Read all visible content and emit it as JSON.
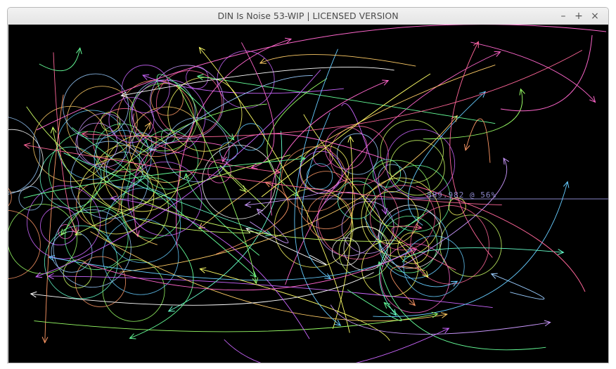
{
  "window": {
    "title": "DIN Is Noise 53-WIP | LICENSED VERSION",
    "minimize_glyph": "–",
    "maximize_glyph": "+",
    "close_glyph": "×"
  },
  "canvas": {
    "background": "#000000",
    "readout": "889.982 @ 56%",
    "readout_color": "#8a86c8",
    "palette": [
      "#ff66cc",
      "#ccff66",
      "#66ff99",
      "#99ccff",
      "#ffcc66",
      "#cc99ff",
      "#66ffcc",
      "#ff9966",
      "#ffff66",
      "#66ccff",
      "#ff6699",
      "#99ff66",
      "#cc66ff",
      "#ffffff"
    ]
  }
}
